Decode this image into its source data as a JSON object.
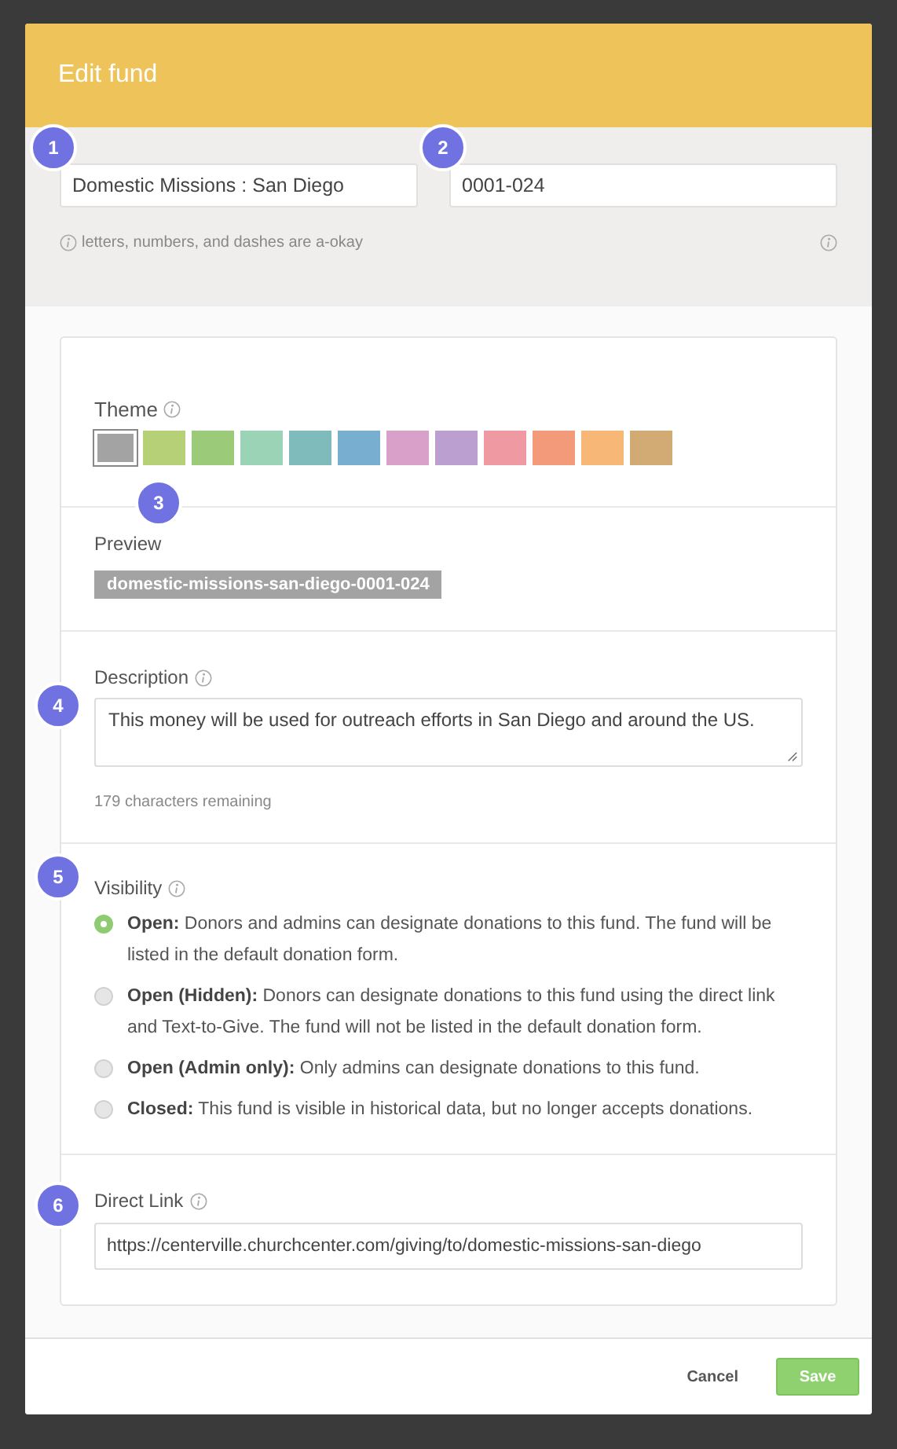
{
  "dialog": {
    "title": "Edit fund"
  },
  "fields": [
    {
      "marker": "1",
      "value": "Domestic Missions : San Diego"
    },
    {
      "marker": "2",
      "value": "0001-024"
    }
  ],
  "hint": "letters, numbers, and dashes are a-okay",
  "theme": {
    "label": "Theme",
    "marker": "3",
    "swatches": [
      {
        "color": "#a3a3a3",
        "selected": true
      },
      {
        "color": "#b6d077",
        "selected": false
      },
      {
        "color": "#9bcb78",
        "selected": false
      },
      {
        "color": "#9ad3b6",
        "selected": false
      },
      {
        "color": "#80bbbb",
        "selected": false
      },
      {
        "color": "#78afd0",
        "selected": false
      },
      {
        "color": "#d9a0c9",
        "selected": false
      },
      {
        "color": "#bb9fd1",
        "selected": false
      },
      {
        "color": "#ef9aa3",
        "selected": false
      },
      {
        "color": "#f39a7a",
        "selected": false
      },
      {
        "color": "#f7b877",
        "selected": false
      },
      {
        "color": "#d2aa73",
        "selected": false
      }
    ]
  },
  "preview": {
    "label": "Preview",
    "tag": "domestic-missions-san-diego-0001-024"
  },
  "description": {
    "label": "Description",
    "marker": "4",
    "value": "This money will be used for outreach efforts in San Diego and around the US.",
    "remaining": "179 characters remaining"
  },
  "visibility": {
    "label": "Visibility",
    "marker": "5",
    "options": [
      {
        "title": "Open:",
        "text": "Donors and admins can designate donations to this fund. The fund will be listed in the default donation form.",
        "selected": true
      },
      {
        "title": "Open (Hidden):",
        "text": "Donors can designate donations to this fund using the direct link and Text-to-Give. The fund will not be listed in the default donation form.",
        "selected": false
      },
      {
        "title": "Open (Admin only):",
        "text": "Only admins can designate donations to this fund.",
        "selected": false
      },
      {
        "title": "Closed:",
        "text": "This fund is visible in historical data, but no longer accepts donations.",
        "selected": false
      }
    ]
  },
  "direct_link": {
    "label": "Direct Link",
    "marker": "6",
    "value": "https://centerville.churchcenter.com/giving/to/domestic-missions-san-diego"
  },
  "buttons": {
    "cancel": "Cancel",
    "save": "Save"
  }
}
